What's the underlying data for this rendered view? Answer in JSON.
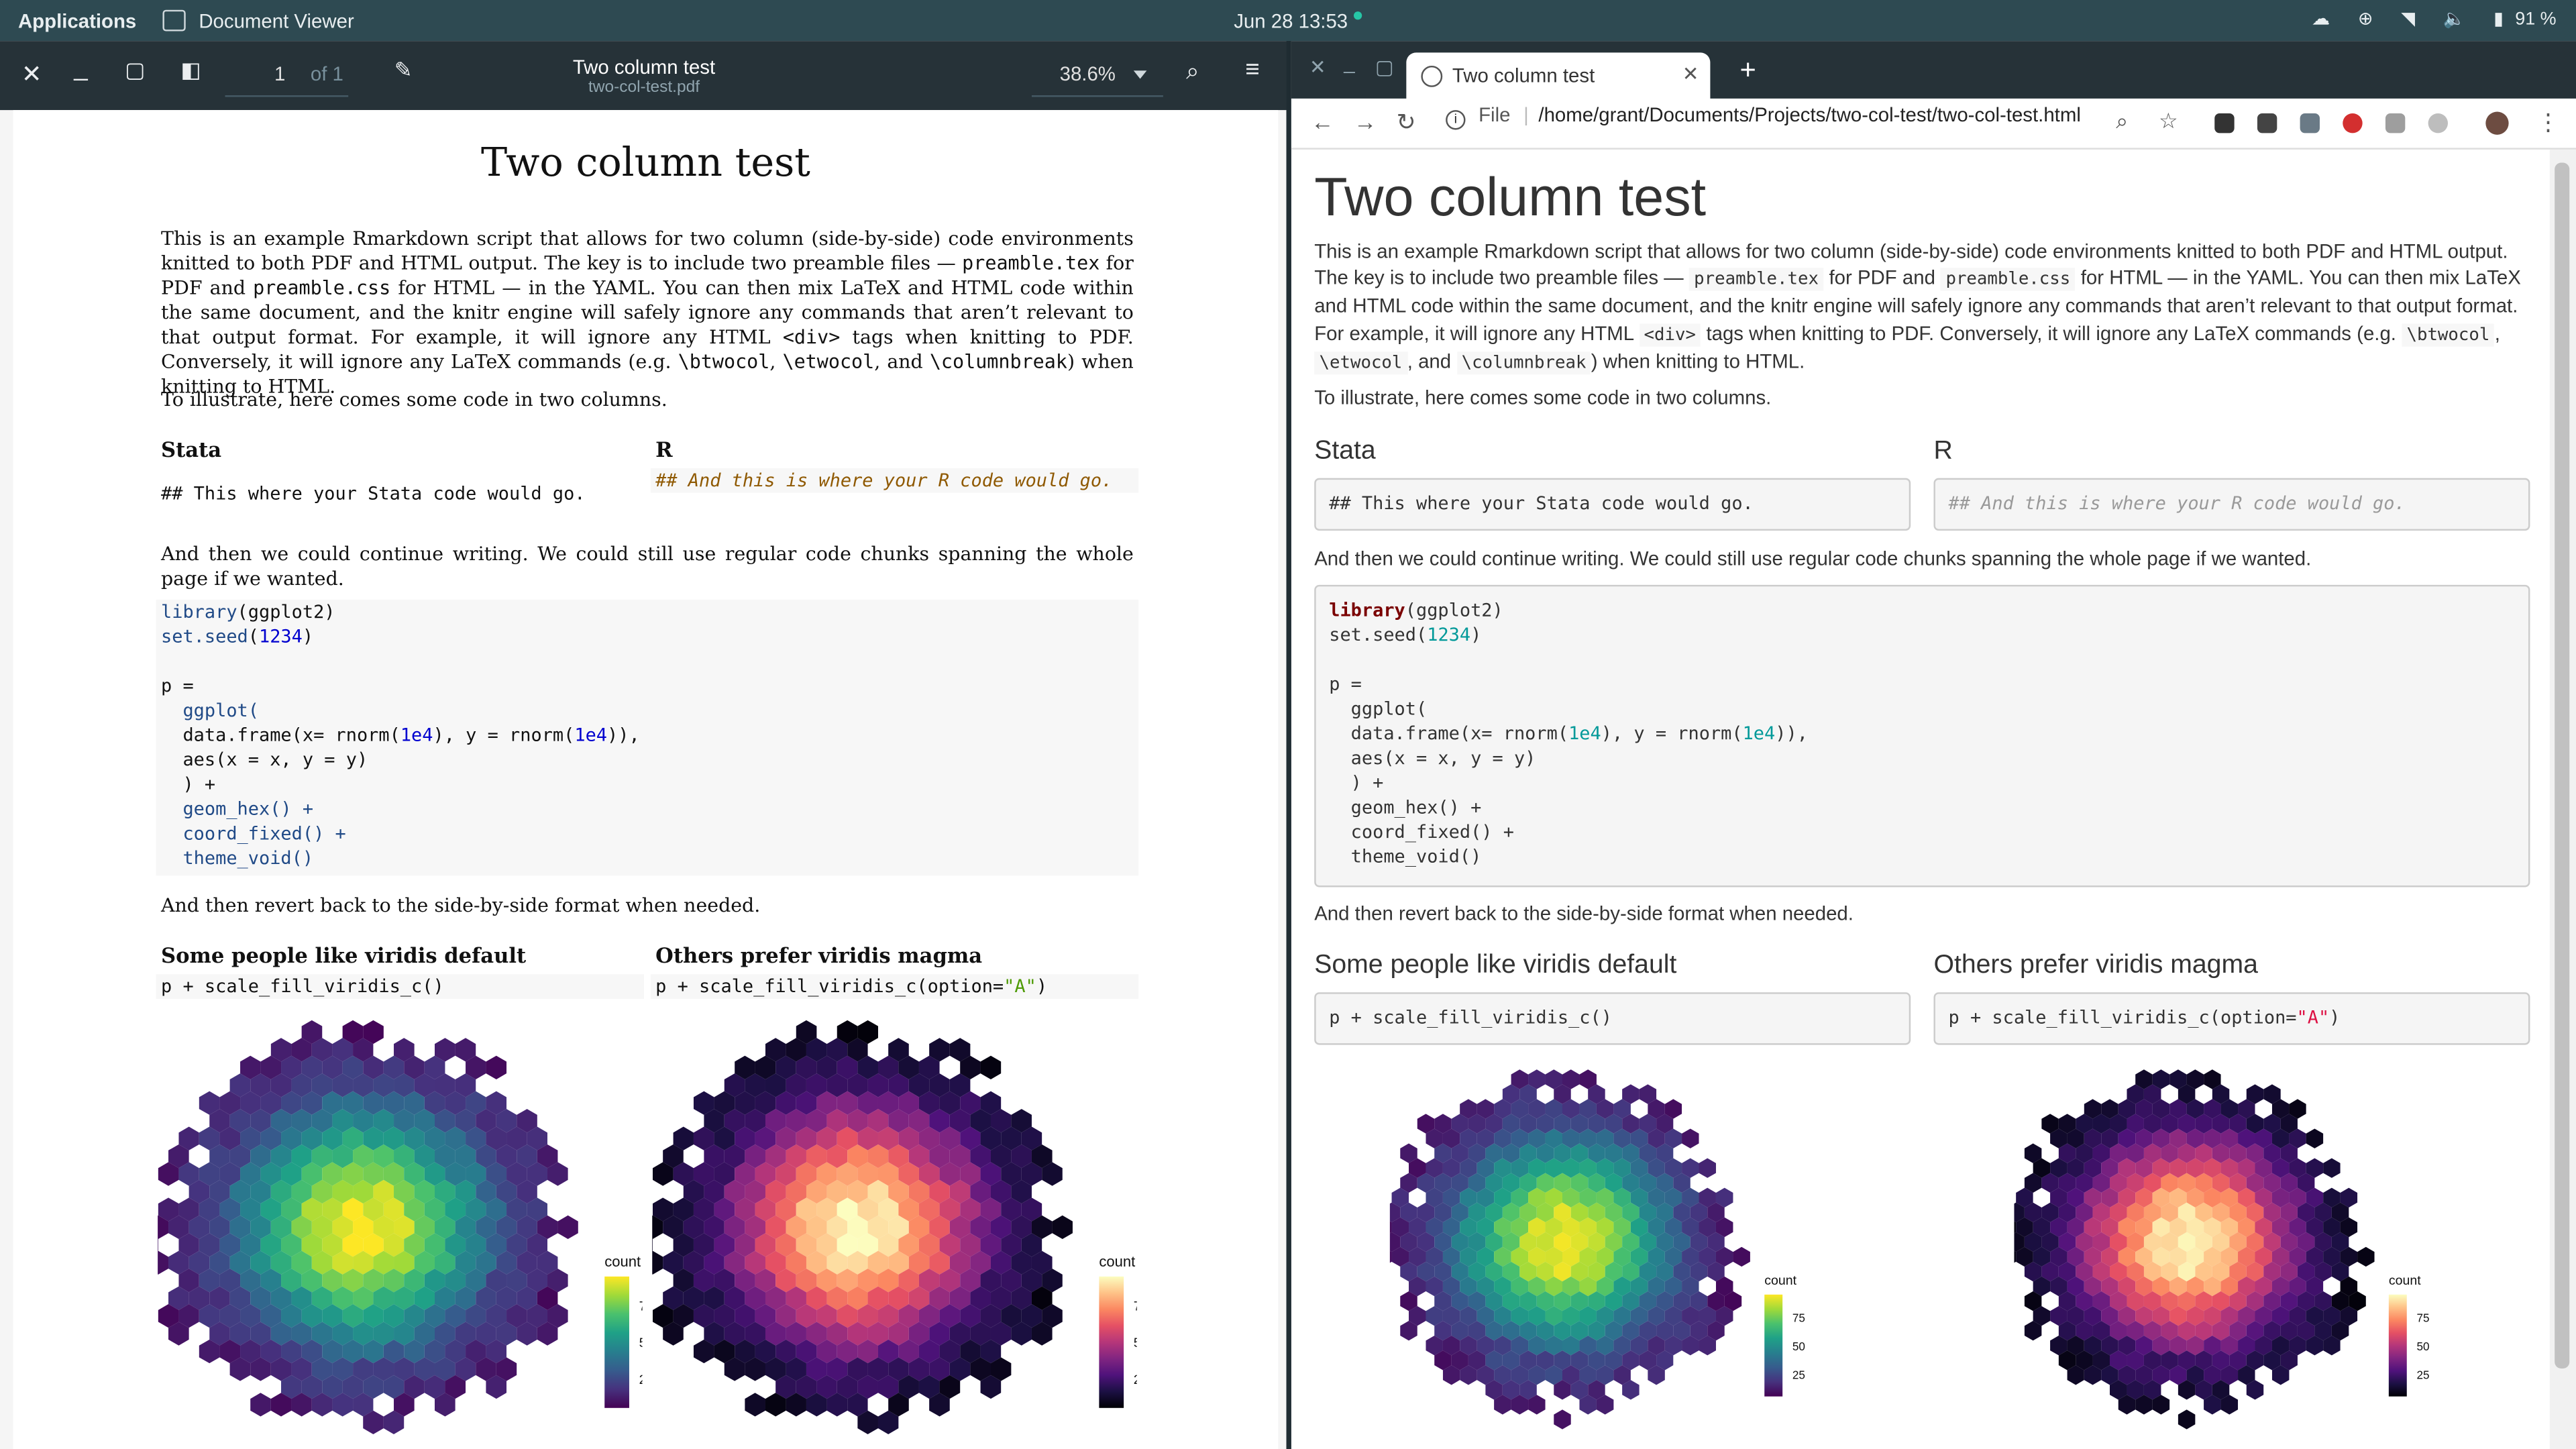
{
  "topbar": {
    "applications": "Applications",
    "app_name": "Document Viewer",
    "clock": "Jun 28  13:53",
    "battery": "91 %"
  },
  "evince": {
    "page_current": "1",
    "page_of": "of 1",
    "doc_title": "Two column test",
    "doc_file": "two-col-test.pdf",
    "zoom": "38.6%"
  },
  "pdf": {
    "title": "Two column test",
    "intro_a": "This is an example Rmarkdown script that allows for two column (side-by-side) code environments knitted to both PDF and HTML output. The key is to include two preamble files — ",
    "intro_b": "preamble.tex",
    "intro_c": " for PDF and ",
    "intro_d": "preamble.css",
    "intro_e": " for HTML — in the YAML. You can then mix LaTeX and HTML code within the same document, and the knitr engine will safely ignore any commands that aren’t relevant to that output format. For example, it will ignore any HTML ",
    "intro_f": "<div>",
    "intro_g": " tags when knitting to PDF. Conversely, it will ignore any LaTeX commands (e.g. ",
    "intro_h": "\\btwocol",
    "intro_i": ", ",
    "intro_j": "\\etwocol",
    "intro_k": ", and ",
    "intro_l": "\\columnbreak",
    "intro_m": ") when knitting to HTML.",
    "illustrate": "To illustrate, here comes some code in two columns.",
    "h_stata": "Stata",
    "h_r": "R",
    "stata_code": "## This where your Stata code would go.",
    "r_code": "## And this is where your R code would go.",
    "continue": "And then we could continue writing. We could still use regular code chunks spanning the whole page if we wanted.",
    "revert": "And then revert back to the side-by-side format when needed.",
    "h_viridis": "Some people like viridis default",
    "h_magma": "Others prefer viridis magma",
    "legend_title": "count",
    "legend_ticks": [
      "7",
      "5",
      "2"
    ]
  },
  "chrome": {
    "tab_title": "Two column test",
    "url_scheme": "File",
    "url": "/home/grant/Documents/Projects/two-col-test/two-col-test.html"
  },
  "web": {
    "title": "Two column test",
    "intro_a": "This is an example Rmarkdown script that allows for two column (side-by-side) code environments knitted to both PDF and HTML output. The key is to include two preamble files — ",
    "intro_b": "preamble.tex",
    "intro_c": " for PDF and ",
    "intro_d": "preamble.css",
    "intro_e": " for HTML — in the YAML. You can then mix LaTeX and HTML code within the same document, and the knitr engine will safely ignore any commands that aren’t relevant to that output format. For example, it will ignore any HTML ",
    "intro_f": "<div>",
    "intro_g": " tags when knitting to PDF. Conversely, it will ignore any LaTeX commands (e.g. ",
    "intro_h": "\\btwocol",
    "intro_i": ", ",
    "intro_j": "\\etwocol",
    "intro_k": ", and ",
    "intro_l": "\\columnbreak",
    "intro_m": ") when knitting to HTML.",
    "illustrate": "To illustrate, here comes some code in two columns.",
    "h_stata": "Stata",
    "h_r": "R",
    "stata_code": "## This where your Stata code would go.",
    "r_code": "## And this is where your R code would go.",
    "continue": "And then we could continue writing. We could still use regular code chunks spanning the whole page if we wanted.",
    "revert": "And then revert back to the side-by-side format when needed.",
    "h_viridis": "Some people like viridis default",
    "h_magma": "Others prefer viridis magma",
    "legend_title": "count",
    "legend_ticks": [
      "75",
      "50",
      "25"
    ]
  },
  "code": {
    "lib": "library",
    "lib_arg": "(ggplot2)",
    "seed_fn": "set.seed",
    "seed_open": "(",
    "seed_num": "1234",
    "seed_close": ")",
    "p_assign": "p =",
    "ggplot": "  ggplot(",
    "df_a": "  data.frame(x= rnorm(",
    "df_n1": "1e4",
    "df_b": "), y = rnorm(",
    "df_n2": "1e4",
    "df_c": ")),",
    "aes": "  aes(x = x, y = y)",
    "close": "  ) +",
    "geom": "  geom_hex() +",
    "coord": "  coord_fixed() +",
    "theme": "  theme_void()",
    "viridis_line": "p + scale_fill_viridis_c()",
    "magma_a": "p + scale_fill_viridis_c(option=",
    "magma_str": "\"A\"",
    "magma_b": ")"
  },
  "colors": {
    "viridis": [
      "#440154",
      "#46327e",
      "#365c8d",
      "#277f8e",
      "#1fa187",
      "#4ac16d",
      "#a0da39",
      "#fde725"
    ],
    "magma": [
      "#000004",
      "#1c1044",
      "#4f127b",
      "#812581",
      "#b5367a",
      "#e55064",
      "#fb8761",
      "#fec287",
      "#fcfdbf"
    ]
  }
}
